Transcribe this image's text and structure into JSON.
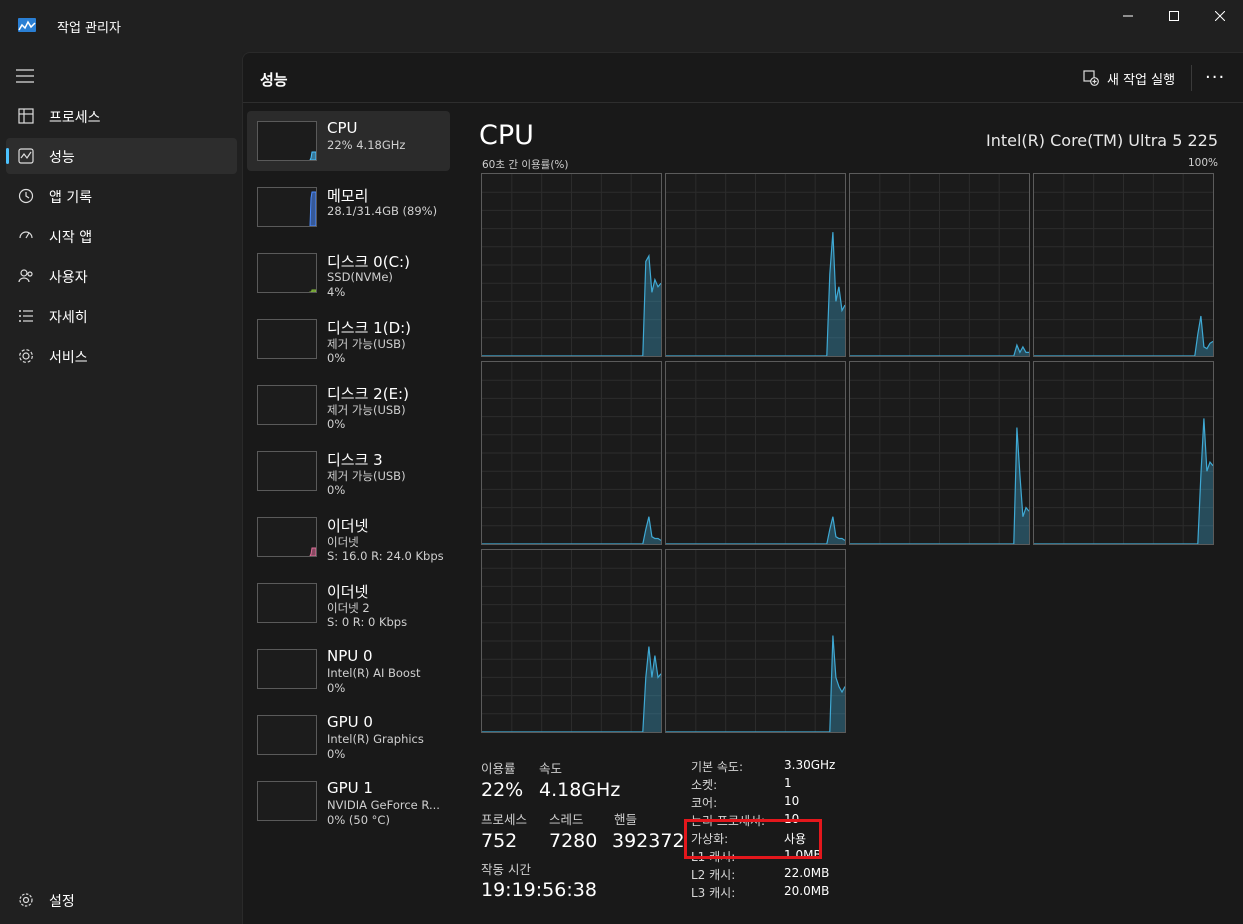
{
  "window": {
    "title": "작업 관리자"
  },
  "nav": {
    "items": [
      {
        "label": "프로세스",
        "icon": "process-icon"
      },
      {
        "label": "성능",
        "icon": "performance-icon",
        "active": true
      },
      {
        "label": "앱 기록",
        "icon": "history-icon"
      },
      {
        "label": "시작 앱",
        "icon": "startup-icon"
      },
      {
        "label": "사용자",
        "icon": "users-icon"
      },
      {
        "label": "자세히",
        "icon": "details-icon"
      },
      {
        "label": "서비스",
        "icon": "services-icon"
      }
    ],
    "settings_label": "설정"
  },
  "header": {
    "title": "성능",
    "new_task_label": "새 작업 실행",
    "more_label": "···"
  },
  "devices": [
    {
      "name": "CPU",
      "line1": "22% 4.18GHz",
      "line2": "",
      "color": "#4cc2ff",
      "level": 0.22
    },
    {
      "name": "메모리",
      "line1": "28.1/31.4GB (89%)",
      "line2": "",
      "color": "#4c8cff",
      "level": 0.89
    },
    {
      "name": "디스크 0(C:)",
      "line1": "SSD(NVMe)",
      "line2": "4%",
      "color": "#8cc63f",
      "level": 0.04
    },
    {
      "name": "디스크 1(D:)",
      "line1": "제거 가능(USB)",
      "line2": "0%",
      "color": "#8cc63f",
      "level": 0
    },
    {
      "name": "디스크 2(E:)",
      "line1": "제거 가능(USB)",
      "line2": "0%",
      "color": "#8cc63f",
      "level": 0
    },
    {
      "name": "디스크 3",
      "line1": "제거 가능(USB)",
      "line2": "0%",
      "color": "#8cc63f",
      "level": 0
    },
    {
      "name": "이더넷",
      "line1": "이더넷",
      "line2": "S: 16.0 R: 24.0 Kbps",
      "color": "#e0709a",
      "level": 0.2
    },
    {
      "name": "이더넷",
      "line1": "이더넷 2",
      "line2": "S: 0 R: 0 Kbps",
      "color": "#e0709a",
      "level": 0
    },
    {
      "name": "NPU 0",
      "line1": "Intel(R) AI Boost",
      "line2": "0%",
      "color": "#4cc2ff",
      "level": 0
    },
    {
      "name": "GPU 0",
      "line1": "Intel(R) Graphics",
      "line2": "0%",
      "color": "#4cc2ff",
      "level": 0
    },
    {
      "name": "GPU 1",
      "line1": "NVIDIA GeForce R...",
      "line2": "0% (50 °C)",
      "color": "#4cc2ff",
      "level": 0
    }
  ],
  "detail": {
    "title": "CPU",
    "model": "Intel(R) Core(TM) Ultra 5 225",
    "graph_label": "60초 간 이용률(%)",
    "graph_max": "100%",
    "stats": {
      "util_label": "이용률",
      "util_value": "22%",
      "speed_label": "속도",
      "speed_value": "4.18GHz",
      "proc_label": "프로세스",
      "proc_value": "752",
      "threads_label": "스레드",
      "threads_value": "7280",
      "handles_label": "핸들",
      "handles_value": "392372",
      "uptime_label": "작동 시간",
      "uptime_value": "19:19:56:38"
    },
    "specs": [
      {
        "label": "기본 속도:",
        "value": "3.30GHz"
      },
      {
        "label": "소켓:",
        "value": "1"
      },
      {
        "label": "코어:",
        "value": "10"
      },
      {
        "label": "논리 프로세서:",
        "value": "10"
      },
      {
        "label": "가상화:",
        "value": "사용"
      },
      {
        "label": "L1 캐시:",
        "value": "1.0MB"
      },
      {
        "label": "L2 캐시:",
        "value": "22.0MB"
      },
      {
        "label": "L3 캐시:",
        "value": "20.0MB"
      }
    ]
  },
  "colors": {
    "accent": "#4cc2ff",
    "graph_line": "#3fa9d4",
    "highlight": "#e3171c"
  },
  "chart_data": {
    "type": "area",
    "title": "60초 간 이용률(%)",
    "ylim": [
      0,
      100
    ],
    "x_points": 60,
    "series": [
      {
        "values": [
          0,
          0,
          0,
          0,
          0,
          0,
          0,
          0,
          0,
          0,
          0,
          0,
          0,
          0,
          0,
          0,
          0,
          0,
          0,
          0,
          0,
          0,
          0,
          0,
          0,
          0,
          0,
          0,
          0,
          0,
          0,
          0,
          0,
          0,
          0,
          0,
          0,
          0,
          0,
          0,
          0,
          0,
          0,
          0,
          0,
          0,
          0,
          0,
          0,
          0,
          0,
          0,
          0,
          0,
          52,
          55,
          35,
          42,
          38,
          40
        ]
      },
      {
        "values": [
          0,
          0,
          0,
          0,
          0,
          0,
          0,
          0,
          0,
          0,
          0,
          0,
          0,
          0,
          0,
          0,
          0,
          0,
          0,
          0,
          0,
          0,
          0,
          0,
          0,
          0,
          0,
          0,
          0,
          0,
          0,
          0,
          0,
          0,
          0,
          0,
          0,
          0,
          0,
          0,
          0,
          0,
          0,
          0,
          0,
          0,
          0,
          0,
          0,
          0,
          0,
          0,
          0,
          0,
          45,
          68,
          30,
          38,
          25,
          28
        ]
      },
      {
        "values": [
          0,
          0,
          0,
          0,
          0,
          0,
          0,
          0,
          0,
          0,
          0,
          0,
          0,
          0,
          0,
          0,
          0,
          0,
          0,
          0,
          0,
          0,
          0,
          0,
          0,
          0,
          0,
          0,
          0,
          0,
          0,
          0,
          0,
          0,
          0,
          0,
          0,
          0,
          0,
          0,
          0,
          0,
          0,
          0,
          0,
          0,
          0,
          0,
          0,
          0,
          0,
          0,
          0,
          0,
          0,
          6,
          2,
          5,
          2,
          2
        ]
      },
      {
        "values": [
          0,
          0,
          0,
          0,
          0,
          0,
          0,
          0,
          0,
          0,
          0,
          0,
          0,
          0,
          0,
          0,
          0,
          0,
          0,
          0,
          0,
          0,
          0,
          0,
          0,
          0,
          0,
          0,
          0,
          0,
          0,
          0,
          0,
          0,
          0,
          0,
          0,
          0,
          0,
          0,
          0,
          0,
          0,
          0,
          0,
          0,
          0,
          0,
          0,
          0,
          0,
          0,
          0,
          0,
          12,
          22,
          5,
          4,
          7,
          8
        ]
      },
      {
        "values": [
          0,
          0,
          0,
          0,
          0,
          0,
          0,
          0,
          0,
          0,
          0,
          0,
          0,
          0,
          0,
          0,
          0,
          0,
          0,
          0,
          0,
          0,
          0,
          0,
          0,
          0,
          0,
          0,
          0,
          0,
          0,
          0,
          0,
          0,
          0,
          0,
          0,
          0,
          0,
          0,
          0,
          0,
          0,
          0,
          0,
          0,
          0,
          0,
          0,
          0,
          0,
          0,
          0,
          0,
          8,
          15,
          4,
          3,
          3,
          2
        ]
      },
      {
        "values": [
          0,
          0,
          0,
          0,
          0,
          0,
          0,
          0,
          0,
          0,
          0,
          0,
          0,
          0,
          0,
          0,
          0,
          0,
          0,
          0,
          0,
          0,
          0,
          0,
          0,
          0,
          0,
          0,
          0,
          0,
          0,
          0,
          0,
          0,
          0,
          0,
          0,
          0,
          0,
          0,
          0,
          0,
          0,
          0,
          0,
          0,
          0,
          0,
          0,
          0,
          0,
          0,
          0,
          0,
          8,
          15,
          4,
          3,
          3,
          2
        ]
      },
      {
        "values": [
          0,
          0,
          0,
          0,
          0,
          0,
          0,
          0,
          0,
          0,
          0,
          0,
          0,
          0,
          0,
          0,
          0,
          0,
          0,
          0,
          0,
          0,
          0,
          0,
          0,
          0,
          0,
          0,
          0,
          0,
          0,
          0,
          0,
          0,
          0,
          0,
          0,
          0,
          0,
          0,
          0,
          0,
          0,
          0,
          0,
          0,
          0,
          0,
          0,
          0,
          0,
          0,
          0,
          0,
          0,
          64,
          38,
          15,
          20,
          18
        ]
      },
      {
        "values": [
          0,
          0,
          0,
          0,
          0,
          0,
          0,
          0,
          0,
          0,
          0,
          0,
          0,
          0,
          0,
          0,
          0,
          0,
          0,
          0,
          0,
          0,
          0,
          0,
          0,
          0,
          0,
          0,
          0,
          0,
          0,
          0,
          0,
          0,
          0,
          0,
          0,
          0,
          0,
          0,
          0,
          0,
          0,
          0,
          0,
          0,
          0,
          0,
          0,
          0,
          0,
          0,
          0,
          0,
          0,
          38,
          69,
          40,
          45,
          43
        ]
      },
      {
        "values": [
          0,
          0,
          0,
          0,
          0,
          0,
          0,
          0,
          0,
          0,
          0,
          0,
          0,
          0,
          0,
          0,
          0,
          0,
          0,
          0,
          0,
          0,
          0,
          0,
          0,
          0,
          0,
          0,
          0,
          0,
          0,
          0,
          0,
          0,
          0,
          0,
          0,
          0,
          0,
          0,
          0,
          0,
          0,
          0,
          0,
          0,
          0,
          0,
          0,
          0,
          0,
          0,
          0,
          0,
          30,
          47,
          30,
          42,
          30,
          32
        ]
      },
      {
        "values": [
          0,
          0,
          0,
          0,
          0,
          0,
          0,
          0,
          0,
          0,
          0,
          0,
          0,
          0,
          0,
          0,
          0,
          0,
          0,
          0,
          0,
          0,
          0,
          0,
          0,
          0,
          0,
          0,
          0,
          0,
          0,
          0,
          0,
          0,
          0,
          0,
          0,
          0,
          0,
          0,
          0,
          0,
          0,
          0,
          0,
          0,
          0,
          0,
          0,
          0,
          0,
          0,
          0,
          0,
          0,
          53,
          30,
          25,
          22,
          25
        ]
      }
    ]
  }
}
